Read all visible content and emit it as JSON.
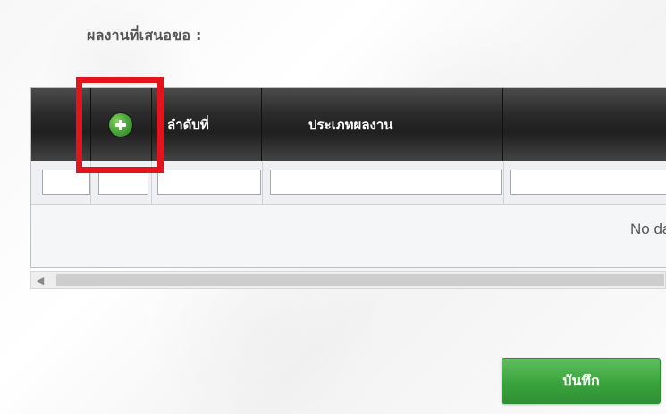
{
  "section": {
    "label": "ผลงานที่เสนอขอ :"
  },
  "grid": {
    "columns": [
      {
        "label": ""
      },
      {
        "label": ""
      },
      {
        "label": "ลำดับที่"
      },
      {
        "label": "ประเภทผลงาน"
      },
      {
        "label": ""
      }
    ],
    "add_button_icon": "plus-circle-icon",
    "filters": [
      {
        "value": "",
        "placeholder": ""
      },
      {
        "value": "",
        "placeholder": ""
      },
      {
        "value": "",
        "placeholder": ""
      },
      {
        "value": "",
        "placeholder": ""
      },
      {
        "value": "",
        "placeholder": ""
      }
    ],
    "empty_text": "No data t"
  },
  "scrollbar": {
    "left_arrow_icon": "chevron-left-icon"
  },
  "actions": {
    "save_label": "บันทึก"
  },
  "colors": {
    "header_dark": "#2b2b2b",
    "accent_green": "#3aa33b",
    "highlight_red": "#e3141b"
  }
}
